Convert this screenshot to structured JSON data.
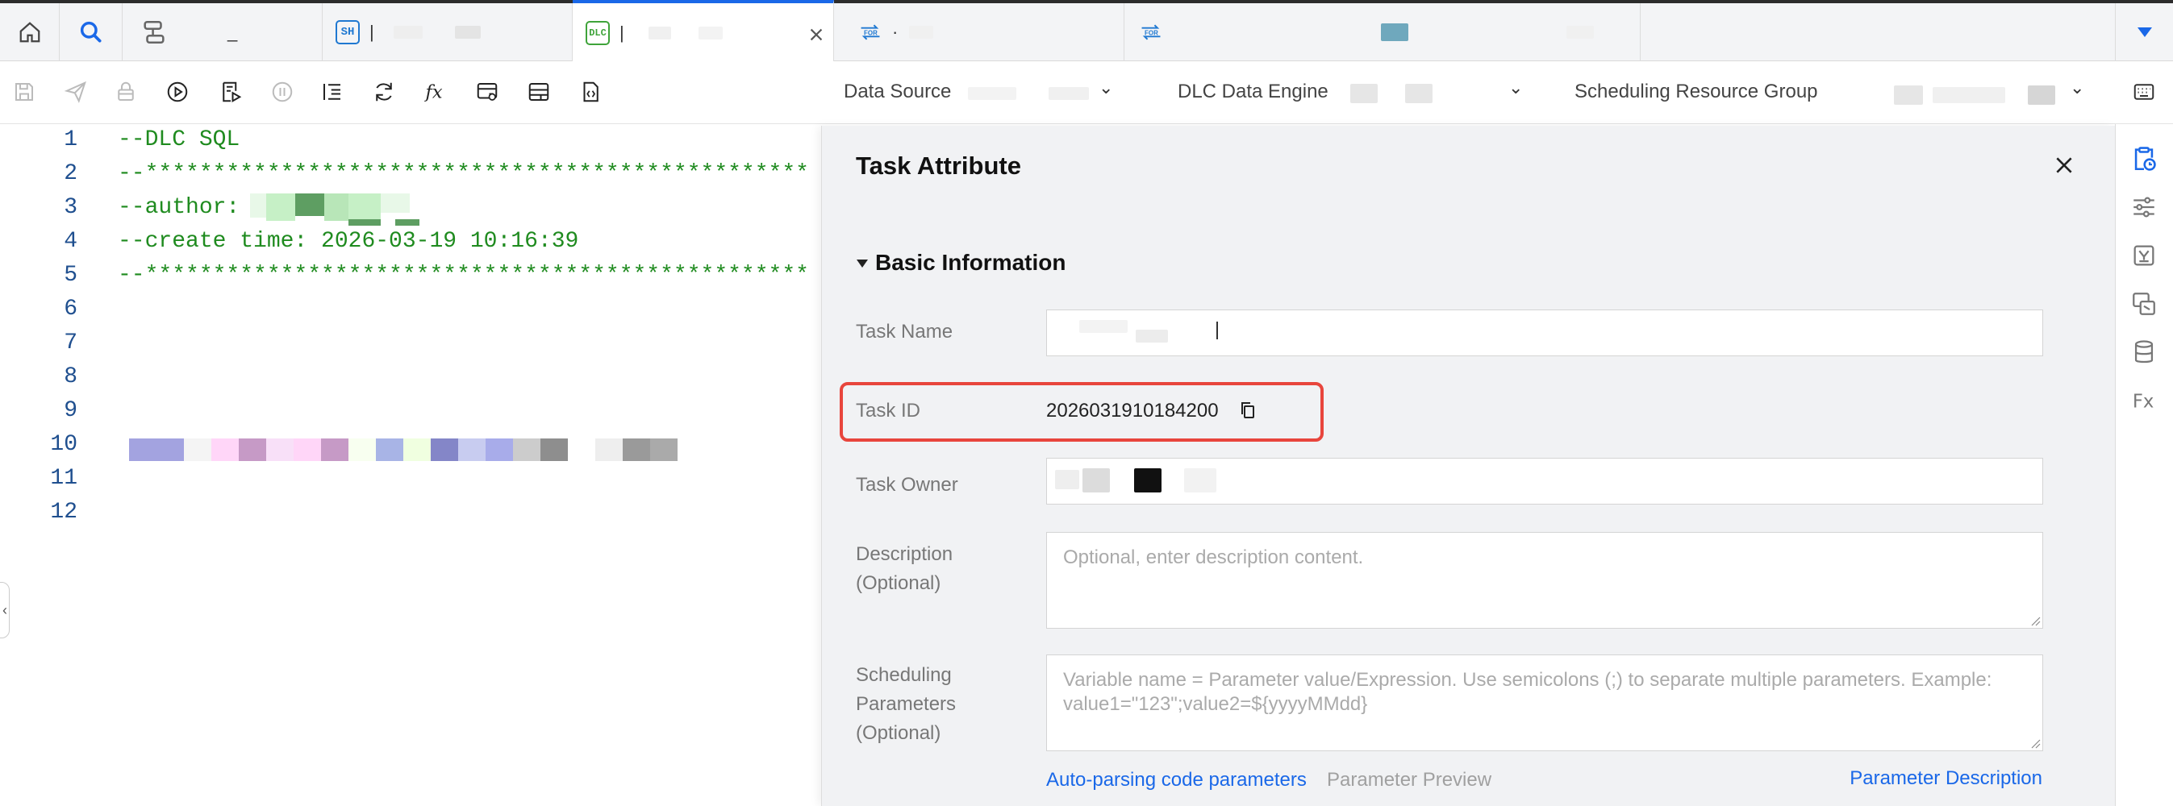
{
  "tabs": [
    {
      "kind": "home"
    },
    {
      "kind": "search"
    },
    {
      "kind": "workflow",
      "label": "_"
    },
    {
      "badge": "SH",
      "label": "|"
    },
    {
      "badge": "DLC",
      "label": "|"
    },
    {
      "badge": "FOR",
      "label": "·"
    },
    {
      "badge": "FOR",
      "label": ""
    }
  ],
  "toolbar": {
    "data_source_label": "Data Source",
    "engine_label": "DLC Data Engine",
    "resource_group_label": "Scheduling Resource Group"
  },
  "editor": {
    "lines": [
      {
        "n": "1",
        "text": "--DLC SQL"
      },
      {
        "n": "2",
        "text": "--*************************************************"
      },
      {
        "n": "3",
        "text": "--author:"
      },
      {
        "n": "4",
        "text": "--create time: 2026-03-19 10:16:39"
      },
      {
        "n": "5",
        "text": "--*************************************************"
      },
      {
        "n": "6",
        "text": ""
      },
      {
        "n": "7",
        "text": ""
      },
      {
        "n": "8",
        "text": ""
      },
      {
        "n": "9",
        "text": ""
      },
      {
        "n": "10",
        "text": ""
      },
      {
        "n": "11",
        "text": ""
      },
      {
        "n": "12",
        "text": ""
      }
    ]
  },
  "panel": {
    "title": "Task Attribute",
    "section": "Basic Information",
    "task_name_label": "Task Name",
    "task_id_label": "Task ID",
    "task_id_value": "2026031910184200",
    "task_owner_label": "Task Owner",
    "description_label": "Description (Optional)",
    "description_placeholder": "Optional, enter description content.",
    "sched_params_label": "Scheduling Parameters (Optional)",
    "sched_params_placeholder": "Variable name = Parameter value/Expression. Use semicolons (;) to separate multiple parameters. Example: value1=\"123\";value2=${yyyyMMdd}",
    "auto_parse_link": "Auto-parsing code parameters",
    "param_preview_link": "Parameter Preview",
    "param_desc_link": "Parameter Description"
  },
  "colors": {
    "accent": "#1a68e8",
    "code_green": "#1f8b1f",
    "highlight_red": "#e8453c"
  }
}
